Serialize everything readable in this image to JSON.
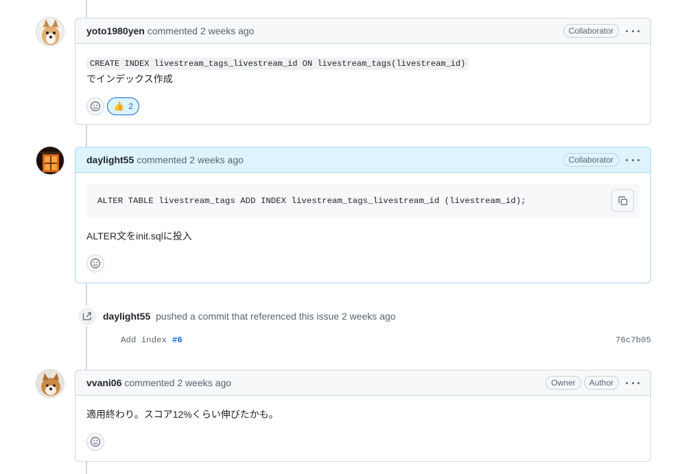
{
  "comments": [
    {
      "author": "yoto1980yen",
      "meta": "commented 2 weeks ago",
      "badges": [
        "Collaborator"
      ],
      "code": "CREATE INDEX livestream_tags_livestream_id ON livestream_tags(livestream_id)",
      "text": "でインデックス作成",
      "reaction": {
        "emoji": "👍",
        "count": "2"
      }
    },
    {
      "author": "daylight55",
      "meta": "commented 2 weeks ago",
      "badges": [
        "Collaborator"
      ],
      "code": "ALTER TABLE livestream_tags ADD INDEX livestream_tags_livestream_id (livestream_id);",
      "text": "ALTER文をinit.sqlに投入"
    },
    {
      "author": "vvani06",
      "meta": "commented 2 weeks ago",
      "badges": [
        "Owner",
        "Author"
      ],
      "text": "適用終わり。スコア12%くらい伸びたかも。"
    }
  ],
  "event": {
    "author": "daylight55",
    "text": "pushed a commit that referenced this issue 2 weeks ago",
    "commit_message": "Add index",
    "commit_ref": "#6",
    "commit_sha": "76c7b05"
  },
  "colors": {
    "accent": "#0969da",
    "highlight_header": "#ddf4ff",
    "border": "#d0d7de"
  }
}
